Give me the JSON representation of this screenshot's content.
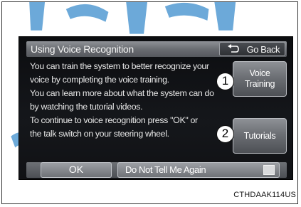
{
  "screen": {
    "title": "Using Voice Recognition",
    "go_back_label": "Go Back",
    "body_lines": [
      "You can train the system to better recognize your",
      "voice by completing the voice training.",
      "You can learn more about what the system can do",
      "by watching the tutorial videos.",
      "To continue to voice recognition press \"OK\" or",
      "the talk switch on your steering wheel."
    ],
    "voice_training_label_1": "Voice",
    "voice_training_label_2": "Training",
    "tutorials_label": "Tutorials",
    "ok_label": "OK",
    "dont_tell_label": "Do Not Tell Me Again"
  },
  "callouts": [
    "1",
    "2"
  ],
  "figure_code": "CTHDAAK114US",
  "colors": {
    "screen_bg": "#101114",
    "button_gray": "#7b7e83",
    "text": "#e6e6e6"
  },
  "icons": {
    "go_back": "back-arrow-icon"
  }
}
